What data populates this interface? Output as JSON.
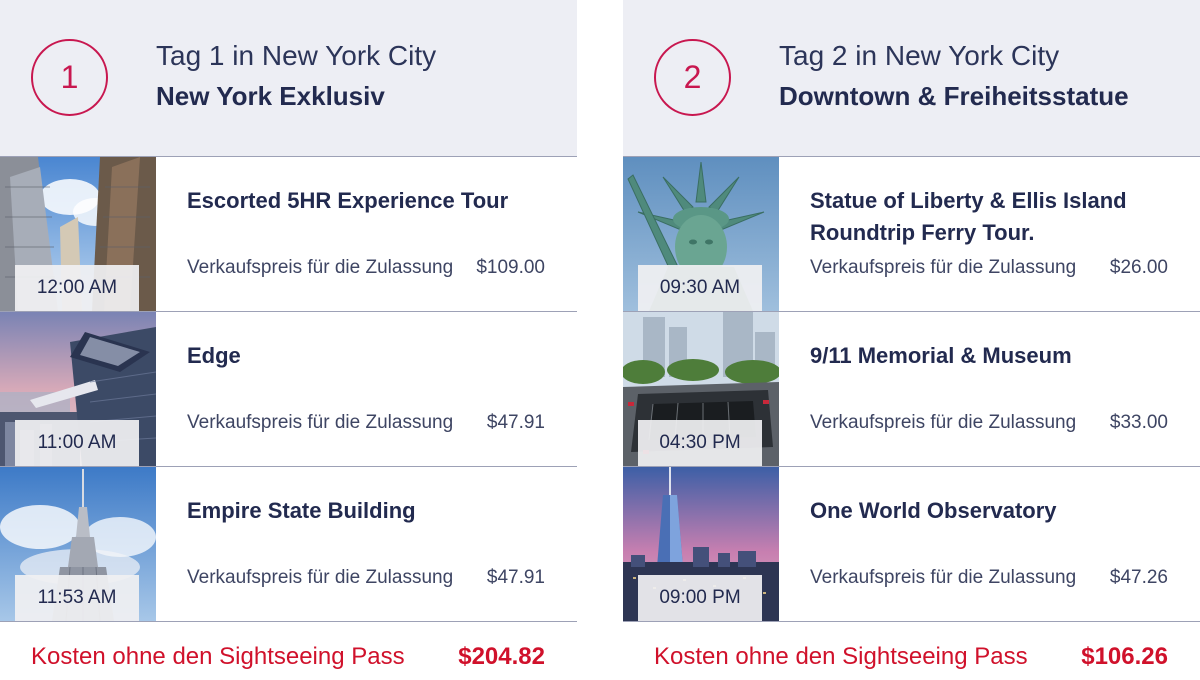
{
  "colors": {
    "accent": "#c8174f",
    "total_text": "#d0112b",
    "header_bg": "#edeef4",
    "text_dark": "#222a4f"
  },
  "days": [
    {
      "number": "1",
      "title": "Tag 1 in New York City",
      "subtitle": "New York Exklusiv",
      "activities": [
        {
          "time": "12:00 AM",
          "name": "Escorted 5HR Experience Tour",
          "price_label": "Verkaufspreis für die Zulassung",
          "price": "$109.00",
          "image": "manhattan-skyscrapers-photo"
        },
        {
          "time": "11:00 AM",
          "name": "Edge",
          "price_label": "Verkaufspreis für die Zulassung",
          "price": "$47.91",
          "image": "edge-observation-deck-photo"
        },
        {
          "time": "11:53 AM",
          "name": "Empire State Building",
          "price_label": "Verkaufspreis für die Zulassung",
          "price": "$47.91",
          "image": "empire-state-building-photo"
        }
      ],
      "total_label": "Kosten ohne den Sightseeing Pass",
      "total": "$204.82"
    },
    {
      "number": "2",
      "title": "Tag 2 in New York City",
      "subtitle": "Downtown & Freiheitsstatue",
      "activities": [
        {
          "time": "09:30 AM",
          "name": "Statue of Liberty & Ellis Island Roundtrip Ferry Tour.",
          "price_label": "Verkaufspreis für die Zulassung",
          "price": "$26.00",
          "image": "statue-of-liberty-photo"
        },
        {
          "time": "04:30 PM",
          "name": "9/11 Memorial & Museum",
          "price_label": "Verkaufspreis für die Zulassung",
          "price": "$33.00",
          "image": "memorial-pool-photo"
        },
        {
          "time": "09:00 PM",
          "name": "One World Observatory",
          "price_label": "Verkaufspreis für die Zulassung",
          "price": "$47.26",
          "image": "one-world-trade-center-photo"
        }
      ],
      "total_label": "Kosten ohne den Sightseeing Pass",
      "total": "$106.26"
    }
  ]
}
